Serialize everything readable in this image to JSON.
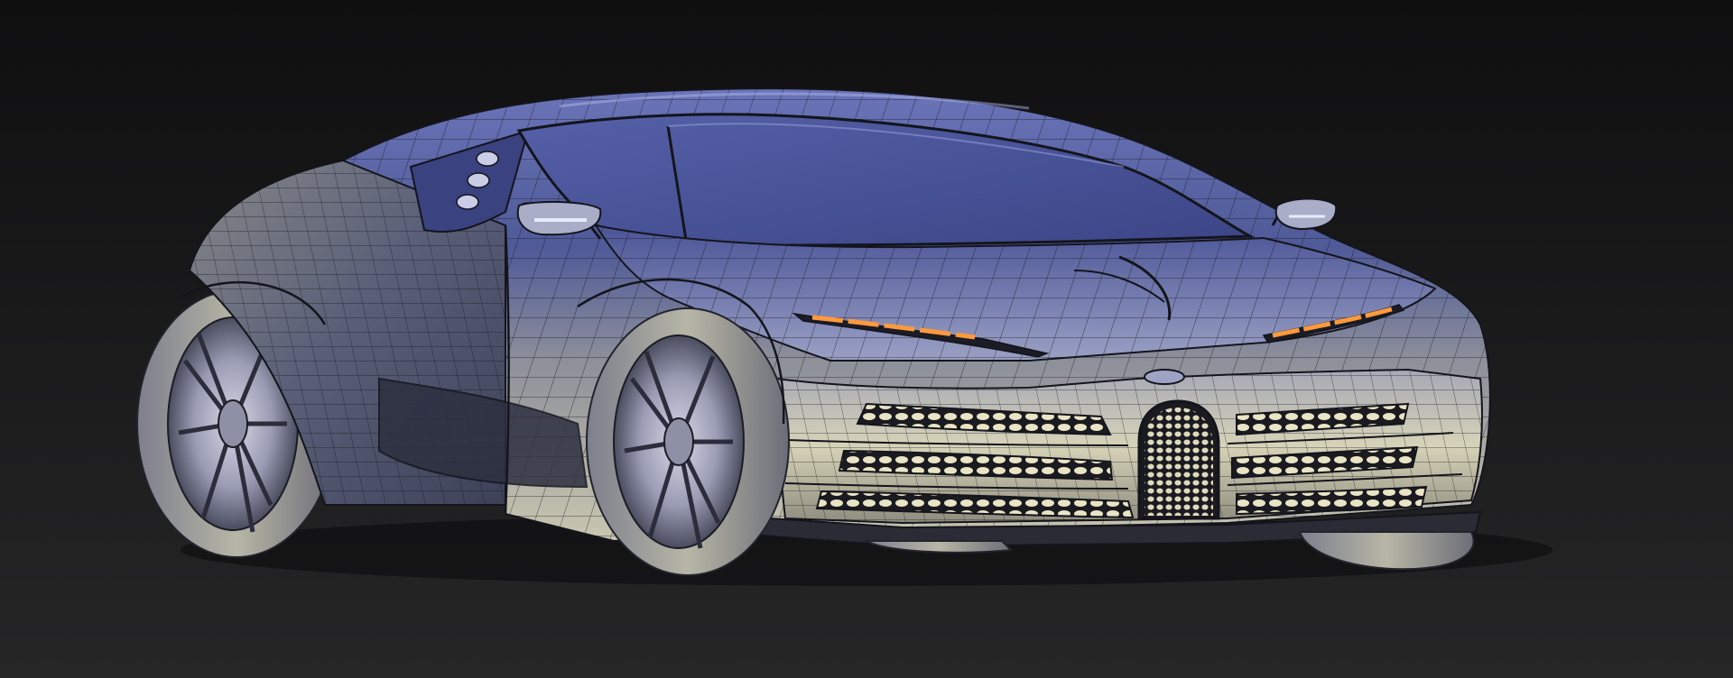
{
  "scene": {
    "subject": "car-wireframe-render",
    "background_top": "#0f0f10",
    "background_bottom": "#262627",
    "body_blue": "#5b67a8",
    "body_silver": "#c9c7b6",
    "wire_color": "#14151c",
    "led_amber": "#ff9a3c"
  }
}
